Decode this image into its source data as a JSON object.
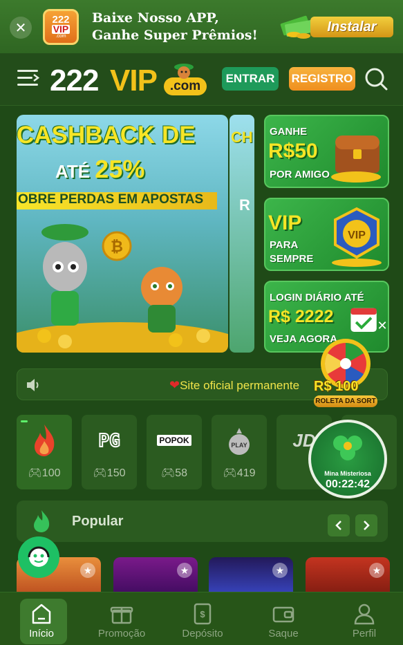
{
  "promo": {
    "logo_line1": "222",
    "logo_line2": "VIP",
    "logo_line3": ".com",
    "line1": "Baixe Nosso APP,",
    "line2": "Ganhe Super Prêmios!",
    "install_label": "Instalar"
  },
  "header": {
    "logo_num": "222",
    "logo_vip": "VIP",
    "logo_com": ".com",
    "login_label": "ENTRAR",
    "register_label": "REGISTRO"
  },
  "banner": {
    "line1": "CASHBACK DE",
    "line2_prefix": "ATÉ ",
    "line2_pct": "25%",
    "line3": "OBRE PERDAS EM APOSTAS",
    "next_line1": "CH",
    "next_line2": "R"
  },
  "cards": [
    {
      "small1": "GANHE",
      "big": "R$50",
      "small2": "POR AMIGO"
    },
    {
      "big": "VIP",
      "small1": "PARA",
      "small2": "SEMPRE"
    },
    {
      "small1": "LOGIN DIÁRIO ATÉ",
      "big": "R$ 2222",
      "small2": "VEJA AGORA"
    }
  ],
  "marquee": {
    "text": "Site oficial permanente"
  },
  "roulette": {
    "amount": "R$ 100",
    "label": "ROLETA DA SORT"
  },
  "providers": [
    {
      "name": "fire",
      "count": "100"
    },
    {
      "name": "PG",
      "count": "150"
    },
    {
      "name": "POPOK",
      "count": "58"
    },
    {
      "name": "PLAY",
      "count": "419"
    },
    {
      "name": "JD",
      "count": ""
    }
  ],
  "mina": {
    "title": "Mina Misteriosa",
    "timer": "00:22:42"
  },
  "popular": {
    "title": "Popular"
  },
  "bottom_nav": [
    {
      "label": "Início"
    },
    {
      "label": "Promoção"
    },
    {
      "label": "Depósito"
    },
    {
      "label": "Saque"
    },
    {
      "label": "Perfil"
    }
  ],
  "colors": {
    "background": "#1f4a17",
    "accent_yellow": "#f6e526",
    "login_green": "#1e9a5a",
    "register_orange": "#ef8f1f"
  }
}
